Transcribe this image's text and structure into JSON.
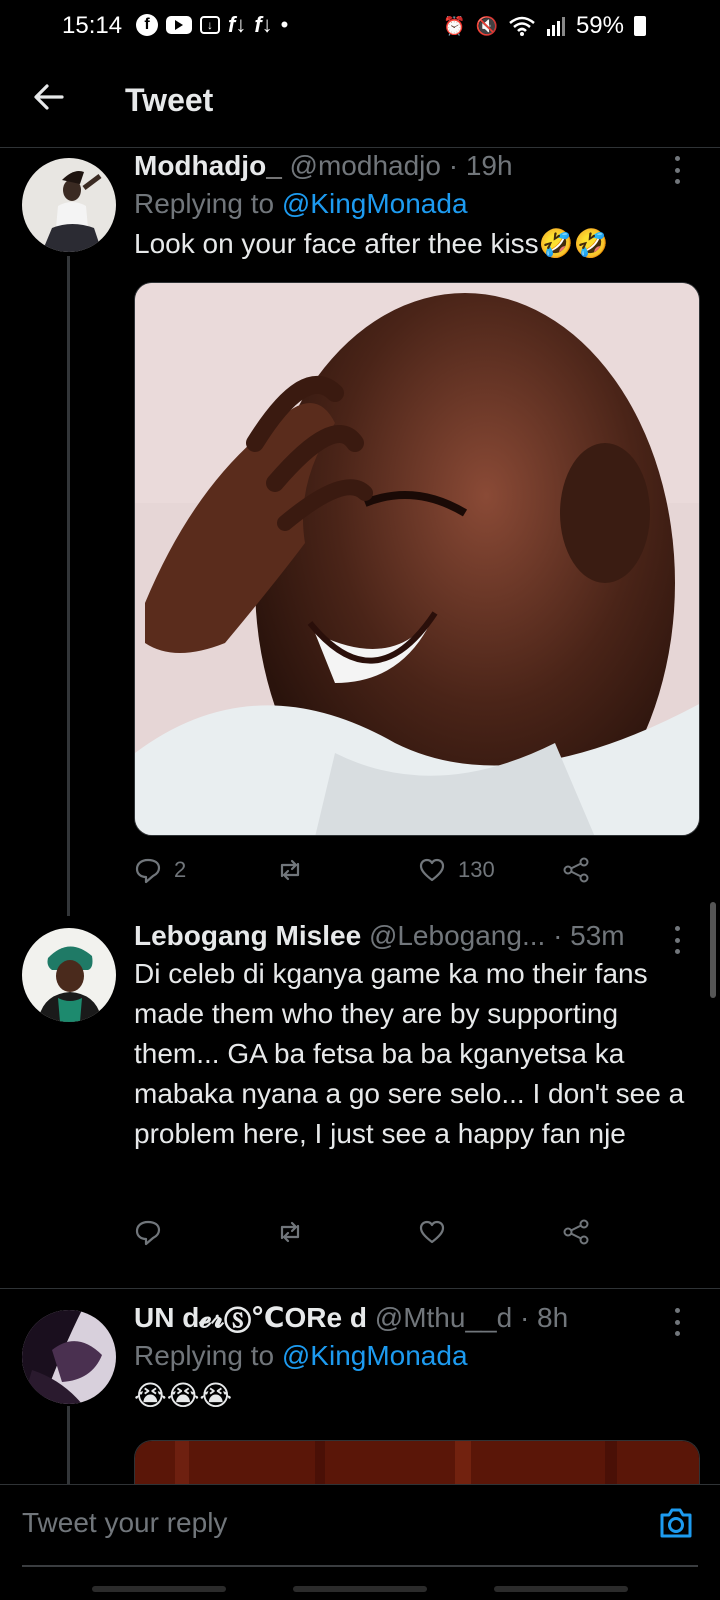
{
  "status_bar": {
    "time": "15:14",
    "battery": "59%",
    "left_icons": [
      "facebook-icon",
      "youtube-icon",
      "download-icon",
      "fl-icon",
      "fl-icon",
      "dot"
    ],
    "right_icons": [
      "alarm-icon",
      "mute-icon",
      "wifi-icon",
      "signal-icon",
      "battery-icon"
    ]
  },
  "header": {
    "title": "Tweet"
  },
  "tweets": [
    {
      "name": "Modhadjo_",
      "handle": "@modhadjo",
      "time": "· 19h",
      "replying_prefix": "Replying to ",
      "replying_to": "@KingMonada",
      "text": "Look on your face after thee kiss🤣🤣",
      "replies": "2",
      "retweets": "",
      "likes": "130"
    },
    {
      "name": "Lebogang Mislee",
      "handle": "@Lebogang...",
      "time": " · 53m",
      "text": "Di celeb di kganya game ka mo their fans made them who they are by supporting them... GA ba fetsa ba ba kganyetsa ka mabaka nyana a go sere selo... I don't see a problem here, I just see a happy fan nje",
      "replies": "",
      "retweets": "",
      "likes": ""
    },
    {
      "name": "UN d𝓮𝓻Ⓢ℃ORe d",
      "handle": "@Mthu__d",
      "time": "· 8h",
      "replying_prefix": "Replying to ",
      "replying_to": "@KingMonada",
      "text": "😭😭😭"
    }
  ],
  "reply_bar": {
    "placeholder": "Tweet your reply"
  },
  "colors": {
    "accent": "#1d9bf0",
    "muted": "#71767b",
    "background": "#000000"
  }
}
